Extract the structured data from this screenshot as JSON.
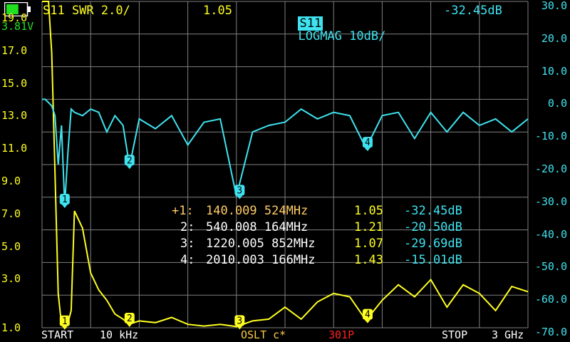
{
  "status": {
    "battery_voltage": "3.81V",
    "battery_level": 0.6
  },
  "header": {
    "swr_trace_label": "S11 SWR 2.0/",
    "swr_value": "1.05",
    "logmag_trace_label": "S11",
    "logmag_format": "LOGMAG 10dB/",
    "logmag_value": "-32.45dB"
  },
  "axes": {
    "left_ticks": [
      "19.0",
      "17.0",
      "15.0",
      "13.0",
      "11.0",
      "9.0",
      "7.0",
      "5.0",
      "3.0",
      "1.0"
    ],
    "right_ticks": [
      "30.0",
      "20.0",
      "10.0",
      "0.0",
      "-10.0",
      "-20.0",
      "-30.0",
      "-40.0",
      "-50.0",
      "-60.0",
      "-70.0"
    ]
  },
  "markers": {
    "rows": [
      {
        "id": "+1:",
        "freq": "140.009 524MHz",
        "swr": "1.05",
        "db": "-32.45dB",
        "active": true
      },
      {
        "id": "2:",
        "freq": "540.008 164MHz",
        "swr": "1.21",
        "db": "-20.50dB",
        "active": false
      },
      {
        "id": "3:",
        "freq": "1220.005 852MHz",
        "swr": "1.07",
        "db": "-29.69dB",
        "active": false
      },
      {
        "id": "4:",
        "freq": "2010.003 166MHz",
        "swr": "1.43",
        "db": "-15.01dB",
        "active": false
      }
    ],
    "badges": [
      "1",
      "2",
      "3",
      "4"
    ]
  },
  "footer": {
    "start_label": "START",
    "start_value": "10 kHz",
    "cal_status": "OSLT c*",
    "points": "301P",
    "stop_label": "STOP",
    "stop_value": "3 GHz"
  },
  "chart_data": {
    "type": "line",
    "x_range": [
      "10 kHz",
      "3 GHz"
    ],
    "series": [
      {
        "name": "S11 SWR",
        "color": "#ffff20",
        "ylim": [
          1,
          20
        ],
        "x_GHz": [
          0,
          0.02,
          0.04,
          0.06,
          0.08,
          0.1,
          0.12,
          0.14,
          0.16,
          0.18,
          0.2,
          0.25,
          0.3,
          0.35,
          0.4,
          0.45,
          0.5,
          0.54,
          0.6,
          0.7,
          0.8,
          0.9,
          1.0,
          1.1,
          1.2,
          1.3,
          1.4,
          1.5,
          1.6,
          1.7,
          1.8,
          1.9,
          2.0,
          2.1,
          2.2,
          2.3,
          2.4,
          2.5,
          2.6,
          2.7,
          2.8,
          2.9,
          3.0
        ],
        "values": [
          20,
          20,
          20,
          17,
          10,
          3,
          1.2,
          1.05,
          1.3,
          2,
          7.8,
          6.8,
          4.2,
          3.2,
          2.6,
          1.8,
          1.5,
          1.21,
          1.4,
          1.3,
          1.6,
          1.2,
          1.1,
          1.2,
          1.07,
          1.4,
          1.5,
          2.2,
          1.5,
          2.5,
          3.0,
          2.8,
          1.43,
          2.6,
          3.5,
          2.8,
          3.8,
          2.2,
          3.5,
          3.0,
          2.0,
          3.4,
          3.1
        ]
      },
      {
        "name": "S11 LOGMAG",
        "color": "#3fe3f0",
        "ylim": [
          -70,
          30
        ],
        "x_GHz": [
          0,
          0.02,
          0.04,
          0.06,
          0.08,
          0.1,
          0.12,
          0.14,
          0.16,
          0.18,
          0.2,
          0.25,
          0.3,
          0.35,
          0.4,
          0.45,
          0.5,
          0.54,
          0.6,
          0.7,
          0.8,
          0.9,
          1.0,
          1.1,
          1.2,
          1.3,
          1.4,
          1.5,
          1.6,
          1.7,
          1.8,
          1.9,
          2.0,
          2.1,
          2.2,
          2.3,
          2.4,
          2.5,
          2.6,
          2.7,
          2.8,
          2.9,
          3.0
        ],
        "values": [
          0,
          0,
          -1,
          -2,
          -5,
          -20,
          -8,
          -32.45,
          -16,
          -3,
          -4,
          -5,
          -3,
          -4,
          -10,
          -5,
          -8,
          -20.5,
          -6,
          -9,
          -5,
          -14,
          -7,
          -6,
          -29.69,
          -10,
          -8,
          -7,
          -3,
          -6,
          -4,
          -5,
          -15.01,
          -5,
          -4,
          -12,
          -4,
          -10,
          -4,
          -8,
          -6,
          -10,
          -6
        ]
      }
    ],
    "marker_points": [
      {
        "id": "1",
        "x_GHz": 0.14,
        "swr": 1.05,
        "db": -32.45
      },
      {
        "id": "2",
        "x_GHz": 0.54,
        "swr": 1.21,
        "db": -20.5
      },
      {
        "id": "3",
        "x_GHz": 1.22,
        "swr": 1.07,
        "db": -29.69
      },
      {
        "id": "4",
        "x_GHz": 2.01,
        "swr": 1.43,
        "db": -15.01
      }
    ]
  }
}
